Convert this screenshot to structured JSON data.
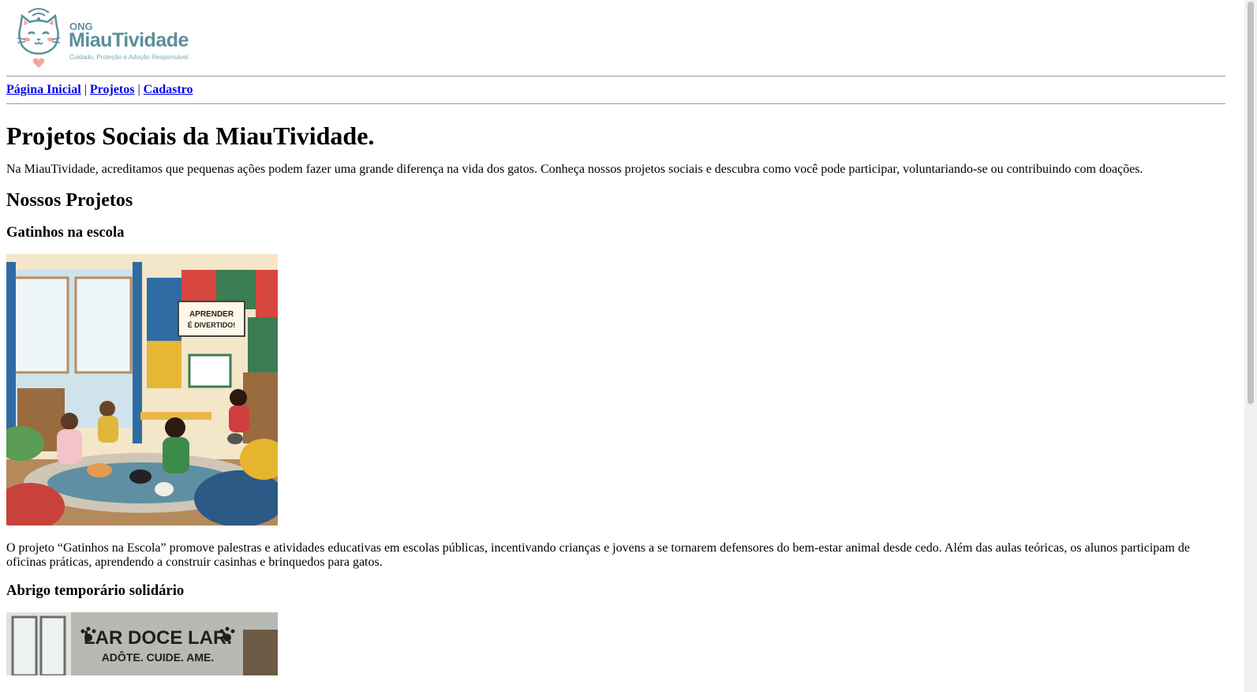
{
  "logo": {
    "ong": "ONG",
    "name": "MiauTividade",
    "tagline": "Cuidado, Proteção e Adoção Responsável",
    "brand_color": "#5b8f9c",
    "accent_color": "#f2a6a0"
  },
  "nav": {
    "home": "Página Inicial",
    "projects": "Projetos",
    "signup": "Cadastro",
    "separator": "|"
  },
  "main": {
    "title": "Projetos Sociais da MiauTividade.",
    "intro": "Na MiauTividade, acreditamos que pequenas ações podem fazer uma grande diferença na vida dos gatos. Conheça nossos projetos sociais e descubra como você pode participar, voluntariando-se ou contribuindo com doações.",
    "section_title": "Nossos Projetos",
    "projects": [
      {
        "title": "Gatinhos na escola",
        "image_sign": "APRENDER É DIVERTIDO!",
        "description": "O projeto “Gatinhos na Escola” promove palestras e atividades educativas em escolas públicas, incentivando crianças e jovens a se tornarem defensores do bem-estar animal desde cedo. Além das aulas teóricas, os alunos participam de oficinas práticas, aprendendo a construir casinhas e brinquedos para gatos."
      },
      {
        "title": "Abrigo temporário solidário",
        "image_sign_line1": "LAR DOCE LAR.",
        "image_sign_line2": "ADÔTE. CUIDE. AME."
      }
    ]
  }
}
